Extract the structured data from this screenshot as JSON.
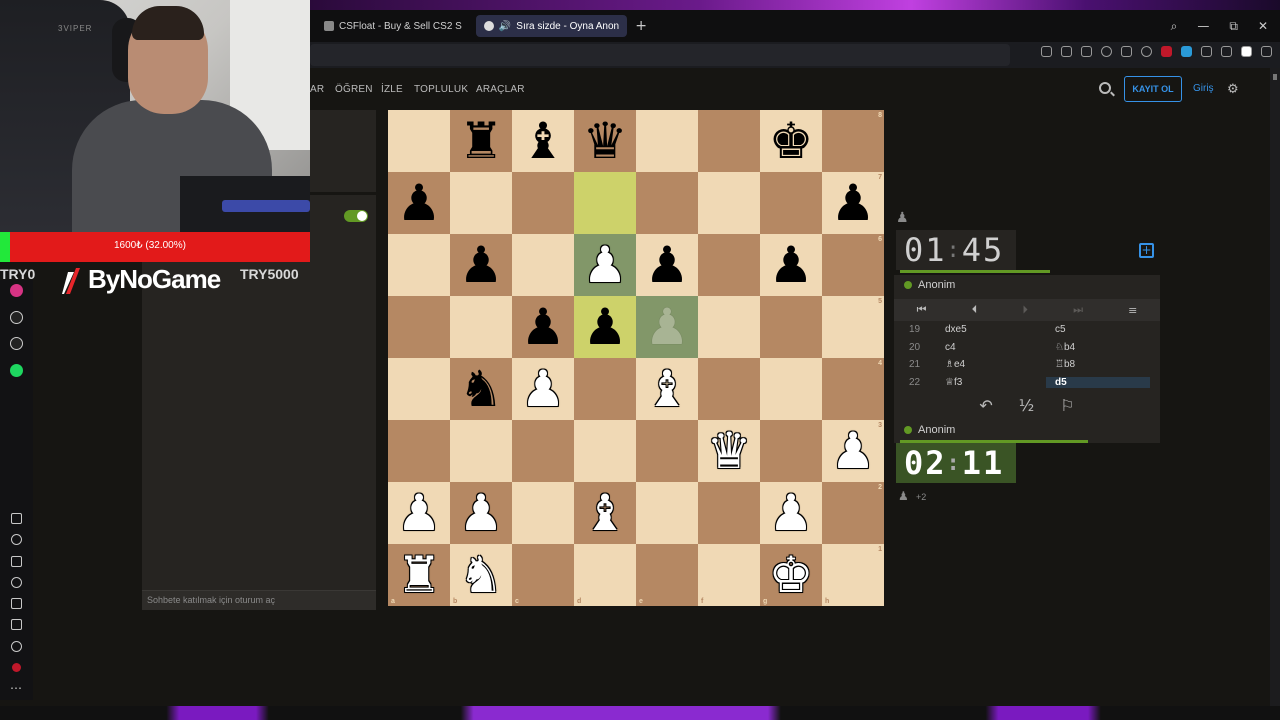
{
  "browser": {
    "tabs": [
      {
        "label": "CSFloat - Buy & Sell CS2 S",
        "active": false
      },
      {
        "label": "Sıra sizde - Oyna Anon",
        "active": true
      }
    ],
    "new_tab": "+",
    "window_controls": [
      "—",
      "⧉",
      "✕"
    ]
  },
  "nav": {
    "items": [
      "AR",
      "ÖĞREN",
      "İZLE",
      "TOPLULUK",
      "ARAÇLAR"
    ],
    "signup": "KAYIT OL",
    "login": "Giriş"
  },
  "overlay": {
    "donation_text": "1600₺ (32.00%)",
    "donation_fraction": 0.32,
    "try_left": "TRY0",
    "try_right": "TRY5000",
    "brand": "ByNoGame",
    "chair_brand": "3VIPER"
  },
  "chat": {
    "placeholder": "Sohbete katılmak için oturum aç"
  },
  "board": {
    "ranks": [
      "8",
      "7",
      "6",
      "5",
      "4",
      "3",
      "2",
      "1"
    ],
    "files": [
      "a",
      "b",
      "c",
      "d",
      "e",
      "f",
      "g",
      "h"
    ],
    "position": [
      [
        "",
        "bR",
        "bB",
        "bQ",
        "",
        "",
        "bK",
        ""
      ],
      [
        "bP",
        "",
        "",
        "",
        "",
        "",
        "",
        "bP"
      ],
      [
        "",
        "bP",
        "",
        "wP",
        "bP",
        "",
        "bP",
        ""
      ],
      [
        "",
        "",
        "bP",
        "bP",
        "gP",
        "",
        "",
        ""
      ],
      [
        "",
        "bN",
        "wP",
        "",
        "wB",
        "",
        "",
        ""
      ],
      [
        "",
        "",
        "",
        "",
        "",
        "wQ",
        "",
        "wP"
      ],
      [
        "wP",
        "wP",
        "",
        "wB",
        "",
        "",
        "wP",
        ""
      ],
      [
        "wR",
        "wN",
        "",
        "",
        "",
        "",
        "wK",
        ""
      ]
    ],
    "highlights": {
      "last_move": [
        "d7",
        "d5"
      ],
      "selected": [
        "d6",
        "e5"
      ]
    }
  },
  "game": {
    "top_clock": {
      "min": "01",
      "sec": "45",
      "sep": ":"
    },
    "bottom_clock": {
      "min": "02",
      "sec": "11",
      "sep": ":"
    },
    "top_player": "Anonim",
    "bottom_player": "Anonim",
    "material_advantage": "+2",
    "moves": [
      {
        "no": "19",
        "white": "dxe5",
        "black": "c5"
      },
      {
        "no": "20",
        "white": "c4",
        "black": "♘b4"
      },
      {
        "no": "21",
        "white": "♗e4",
        "black": "♖b8"
      },
      {
        "no": "22",
        "white": "♕f3",
        "black": "d5"
      }
    ],
    "actions": {
      "takeback": "↶",
      "draw": "½",
      "resign": "⚐"
    },
    "nav_buttons": [
      "⏮",
      "⏴",
      "⏵",
      "⏭",
      "≡"
    ]
  }
}
